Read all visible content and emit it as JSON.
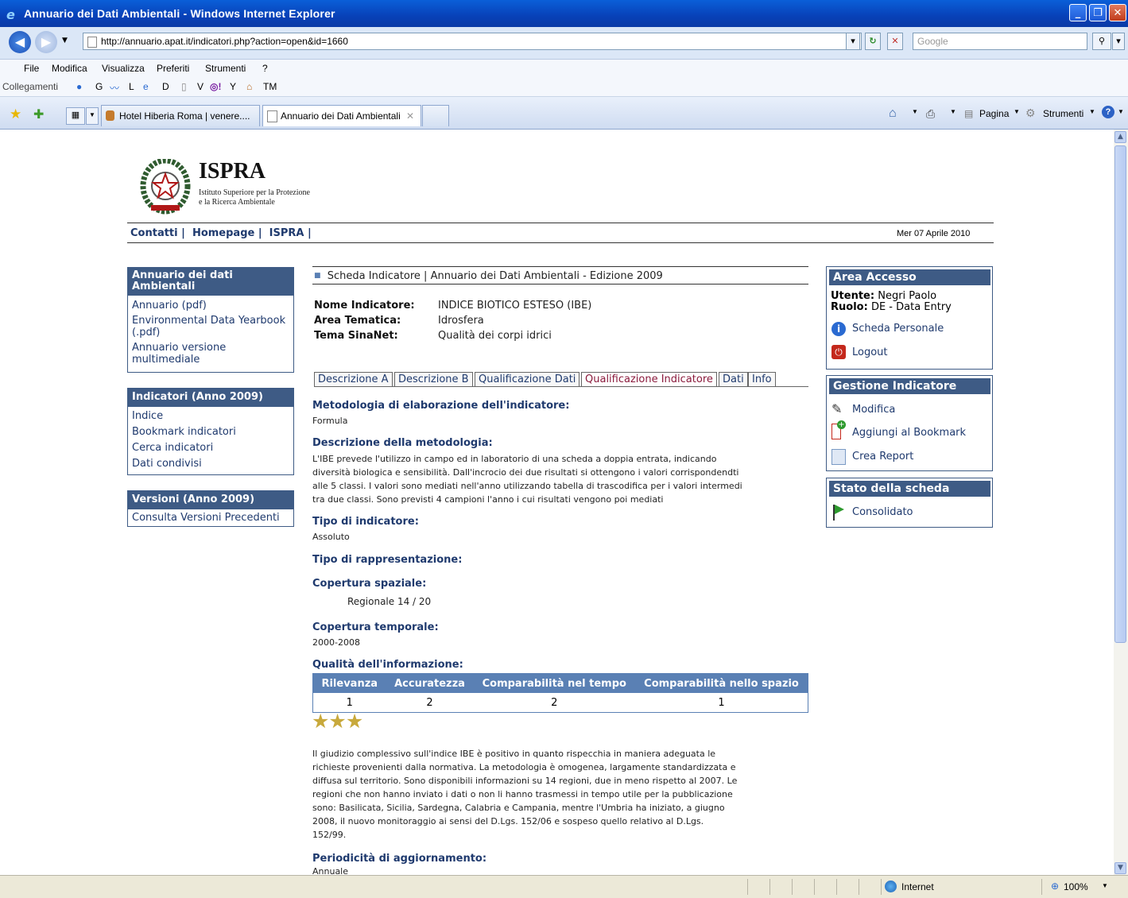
{
  "window": {
    "title": "Annuario dei Dati Ambientali - Windows Internet Explorer"
  },
  "browser": {
    "url": "http://annuario.apat.it/indicatori.php?action=open&id=1660",
    "search_placeholder": "Google",
    "menu": [
      "File",
      "Modifica",
      "Visualizza",
      "Preferiti",
      "Strumenti",
      "?"
    ],
    "links_label": "Collegamenti",
    "links": [
      "G",
      "L",
      "D",
      "V",
      "Y",
      "TM"
    ],
    "tabs": [
      "Hotel Hiberia Roma | venere....",
      "Annuario dei Dati Ambientali"
    ],
    "tools": {
      "page": "Pagina",
      "tools": "Strumenti"
    },
    "status": {
      "zone": "Internet",
      "zoom": "100%"
    }
  },
  "header": {
    "logo_title": "ISPRA",
    "logo_sub1": "Istituto Superiore per la Protezione",
    "logo_sub2": "e la Ricerca Ambientale",
    "nav": [
      "Contatti",
      "Homepage",
      "ISPRA"
    ],
    "date": "Mer 07 Aprile 2010"
  },
  "left": {
    "boxes": [
      {
        "title": "Annuario dei dati Ambientali",
        "items": [
          "Annuario (pdf)",
          "Environmental Data Yearbook (.pdf)",
          "Annuario versione multimediale"
        ]
      },
      {
        "title": "Indicatori (Anno 2009)",
        "items": [
          "Indice",
          "Bookmark indicatori",
          "Cerca indicatori",
          "Dati condivisi"
        ]
      },
      {
        "title": "Versioni (Anno 2009)",
        "items": [
          "Consulta Versioni Precedenti"
        ]
      }
    ]
  },
  "main": {
    "breadcrumb": "Scheda Indicatore | Annuario dei Dati Ambientali - Edizione 2009",
    "meta": [
      {
        "label": "Nome Indicatore:",
        "value": "INDICE BIOTICO ESTESO (IBE)"
      },
      {
        "label": "Area Tematica:",
        "value": "Idrosfera"
      },
      {
        "label": "Tema SinaNet:",
        "value": "Qualità dei corpi idrici"
      }
    ],
    "tabs": [
      "Descrizione A",
      "Descrizione B",
      "Qualificazione Dati",
      "Qualificazione Indicatore",
      "Dati",
      "Info"
    ],
    "sections": {
      "metodologia_title": "Metodologia di elaborazione dell'indicatore:",
      "metodologia_value": "Formula",
      "descrizione_title": "Descrizione della metodologia:",
      "descrizione_lines": [
        "L'IBE prevede l'utilizzo in campo ed in laboratorio di una scheda a doppia entrata, indicando",
        "diversità biologica e sensibilità. Dall'incrocio dei due risultati si ottengono i valori corrispondendti",
        "alle 5 classi. I valori sono mediati nell'anno utilizzando tabella di trascodifica per i valori intermedi",
        "tra due classi. Sono previsti 4 campioni l'anno i cui risultati vengono poi mediati"
      ],
      "tipo_ind_title": "Tipo di indicatore:",
      "tipo_ind_value": "Assoluto",
      "tipo_rapp_title": "Tipo di rappresentazione:",
      "cop_spaz_title": "Copertura spaziale:",
      "cop_spaz_value": "Regionale 14 / 20",
      "cop_temp_title": "Copertura temporale:",
      "cop_temp_value": "2000-2008",
      "qualita_title": "Qualità dell'informazione:",
      "qualita_table": {
        "headers": [
          "Rilevanza",
          "Accuratezza",
          "Comparabilità nel tempo",
          "Comparabilità nello spazio"
        ],
        "values": [
          "1",
          "2",
          "2",
          "1"
        ]
      },
      "stars": "★★★",
      "giudizio_lines": [
        "Il giudizio complessivo sull'indice IBE è positivo in quanto rispecchia in maniera adeguata le",
        "richieste provenienti dalla normativa. La metodologia è omogenea, largamente standardizzata e",
        "diffusa sul territorio. Sono disponibili informazioni su 14 regioni, due in meno rispetto al 2007. Le",
        "regioni che non hanno inviato i dati o non li hanno trasmessi in tempo utile per la pubblicazione",
        "sono: Basilicata, Sicilia, Sardegna, Calabria e Campania, mentre l'Umbria ha iniziato, a giugno",
        "2008, il nuovo monitoraggio ai sensi del D.Lgs. 152/06 e sospeso quello relativo al D.Lgs.",
        "152/99."
      ],
      "periodicita_title": "Periodicità di aggiornamento:",
      "periodicita_value": "Annuale"
    }
  },
  "right": {
    "accesso": {
      "title": "Area Accesso",
      "user_label": "Utente:",
      "user": "Negri Paolo",
      "role_label": "Ruolo:",
      "role": "DE - Data Entry",
      "links": [
        "Scheda Personale",
        "Logout"
      ]
    },
    "gestione": {
      "title": "Gestione Indicatore",
      "links": [
        "Modifica",
        "Aggiungi al Bookmark",
        "Crea Report"
      ]
    },
    "stato": {
      "title": "Stato della scheda",
      "value": "Consolidato"
    }
  },
  "colors": {
    "accent": "#3e5b85",
    "table_head": "#5a80b4",
    "star": "#c8a93c"
  }
}
